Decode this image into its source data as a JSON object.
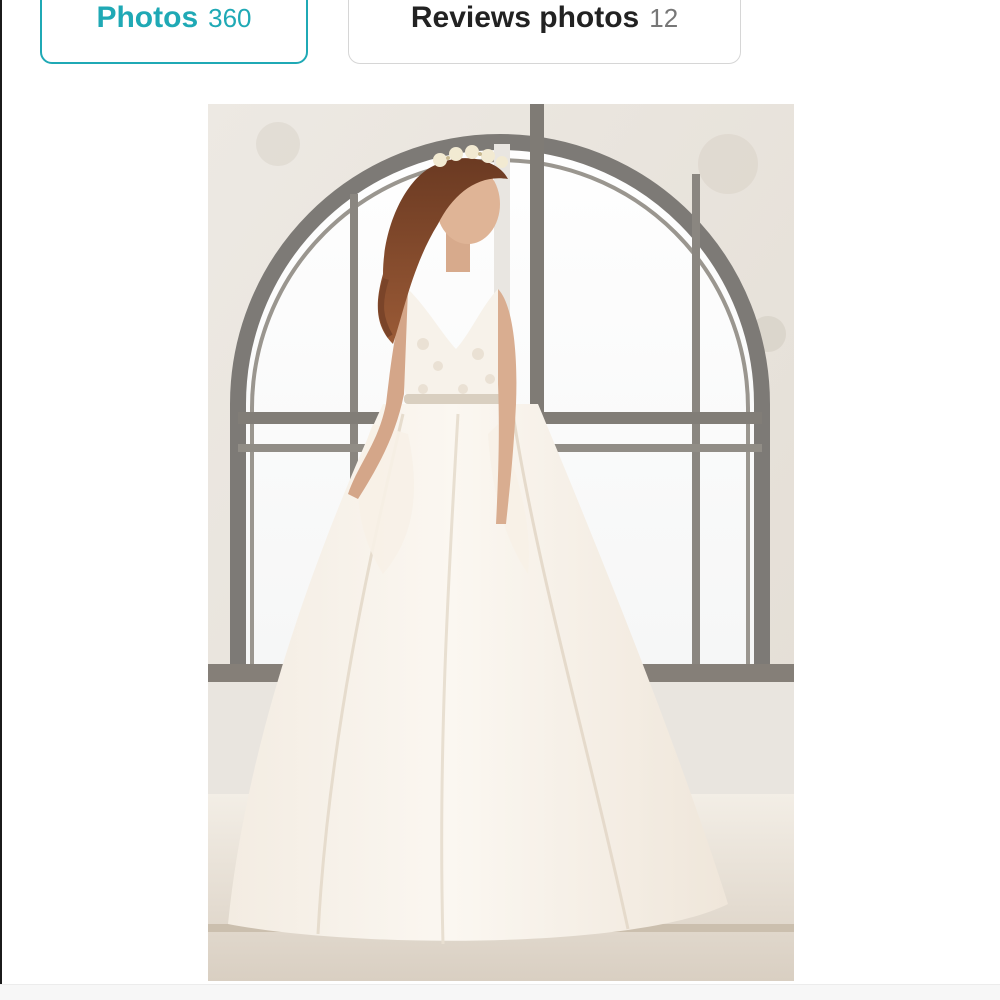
{
  "gallery_tabs": {
    "photos": {
      "label": "Photos",
      "count": "360"
    },
    "reviews_photos": {
      "label": "Reviews photos",
      "count": "12"
    }
  },
  "colors": {
    "accent": "#1fa9b5",
    "inactive_border": "#d6d6d6"
  },
  "photo": {
    "subject": "bride-in-ivory-ball-gown"
  }
}
